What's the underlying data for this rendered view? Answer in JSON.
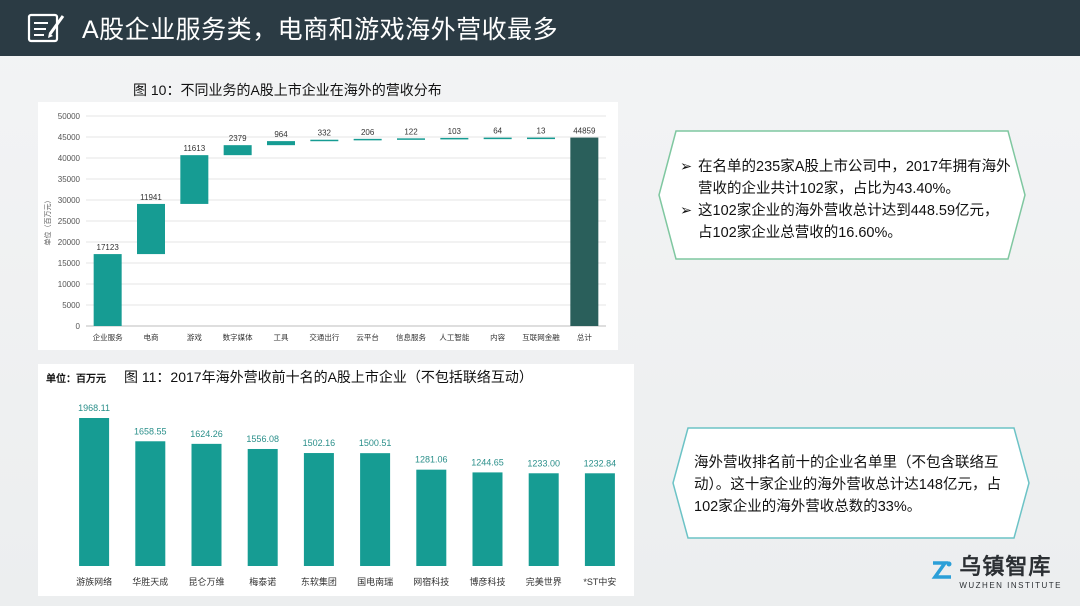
{
  "header": {
    "title": "A股企业服务类，电商和游戏海外营收最多",
    "icon": "edit-document-icon"
  },
  "figure10": {
    "title": "图 10：不同业务的A股上市企业在海外的营收分布",
    "ylabel": "单位（百万元）"
  },
  "figure11": {
    "title": "图 11：2017年海外营收前十名的A股上市企业（不包括联络互动）",
    "unit": "单位：百万元"
  },
  "callout1": {
    "bullets": [
      "在名单的235家A股上市公司中，2017年拥有海外营收的企业共计102家，占比为43.40%。",
      " 这102家企业的海外营收总计达到448.59亿元，占102家企业总营收的16.60%。"
    ]
  },
  "callout2": {
    "text": "海外营收排名前十的企业名单里（不包含联络互动）。这十家企业的海外营收总计达148亿元，占102家企业的海外营收总数的33%。"
  },
  "logo": {
    "zh": "乌镇智库",
    "en": "WUZHEN  INSTITUTE"
  },
  "colors": {
    "bar": "#169c93",
    "total": "#2a5f5b",
    "header": "#2b3b44",
    "grid": "#e4e4e4"
  },
  "chart_data": [
    {
      "type": "bar",
      "subtype": "waterfall",
      "title": "图 10：不同业务的A股上市企业在海外的营收分布",
      "ylabel": "单位（百万元）",
      "ylim": [
        0,
        50000
      ],
      "yticks": [
        0,
        5000,
        10000,
        15000,
        20000,
        25000,
        30000,
        35000,
        40000,
        45000,
        50000
      ],
      "grid": true,
      "categories": [
        "企业服务",
        "电商",
        "游戏",
        "数字媒体",
        "工具",
        "交通出行",
        "云平台",
        "信息服务",
        "人工智能",
        "内容",
        "互联网金融",
        "总计"
      ],
      "values": [
        17123,
        11941,
        11613,
        2379,
        964,
        332,
        206,
        122,
        103,
        64,
        13,
        44859
      ]
    },
    {
      "type": "bar",
      "title": "图 11：2017年海外营收前十名的A股上市企业（不包括联络互动）",
      "unit": "单位：百万元",
      "grid": false,
      "categories": [
        "游族网络",
        "华胜天成",
        "昆仑万维",
        "梅泰诺",
        "东软集团",
        "国电南瑞",
        "网宿科技",
        "博彦科技",
        "完美世界",
        "*ST中安"
      ],
      "values": [
        1968.11,
        1658.55,
        1624.26,
        1556.08,
        1502.16,
        1500.51,
        1281.06,
        1244.65,
        1233.0,
        1232.84
      ],
      "value_labels": [
        "1968.11",
        "1658.55",
        "1624.26",
        "1556.08",
        "1502.16",
        "1500.51",
        "1281.06",
        "1244.65",
        "1233.00",
        "1232.84"
      ]
    }
  ]
}
